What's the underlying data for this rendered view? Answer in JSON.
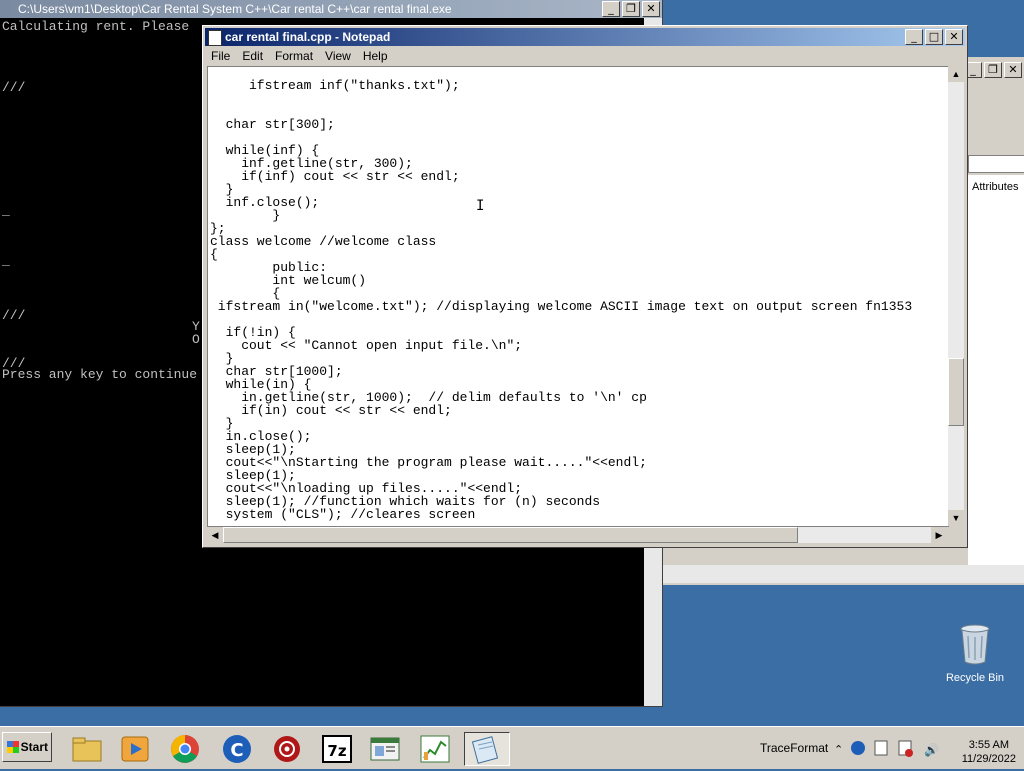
{
  "console": {
    "title": "C:\\Users\\vm1\\Desktop\\Car Rental System C++\\Car rental C++\\car rental final.exe",
    "lines": [
      "Calculating rent. Please",
      "///",
      "_",
      "_",
      "///",
      "///",
      "Press any key to continue"
    ],
    "side_chars": [
      "Y",
      "O"
    ]
  },
  "notepad": {
    "title": "car rental final.cpp - Notepad",
    "menu": [
      "File",
      "Edit",
      "Format",
      "View",
      "Help"
    ],
    "code": "     ifstream inf(\"thanks.txt\");\n\n\n  char str[300];\n\n  while(inf) {\n    inf.getline(str, 300);\n    if(inf) cout << str << endl;\n  }\n  inf.close();\n        }\n};\nclass welcome //welcome class\n{\n        public:\n        int welcum()\n        {\n ifstream in(\"welcome.txt\"); //displaying welcome ASCII image text on output screen fn1353\n\n  if(!in) {\n    cout << \"Cannot open input file.\\n\";\n  }\n  char str[1000];\n  while(in) {\n    in.getline(str, 1000);  // delim defaults to '\\n' cp\n    if(in) cout << str << endl;\n  }\n  in.close();\n  sleep(1);\n  cout<<\"\\nStarting the program please wait.....\"<<endl;\n  sleep(1);\n  cout<<\"\\nloading up files.....\"<<endl;\n  sleep(1); //function which waits for (n) seconds\n  system (\"CLS\"); //cleares screen"
  },
  "background_window": {
    "attributes_label": "Attributes"
  },
  "desktop": {
    "recycle_bin_label": "Recycle Bin"
  },
  "taskbar": {
    "start_label": "Start",
    "tray_label": "TraceFormat",
    "time": "3:55 AM",
    "date": "11/29/2022"
  }
}
